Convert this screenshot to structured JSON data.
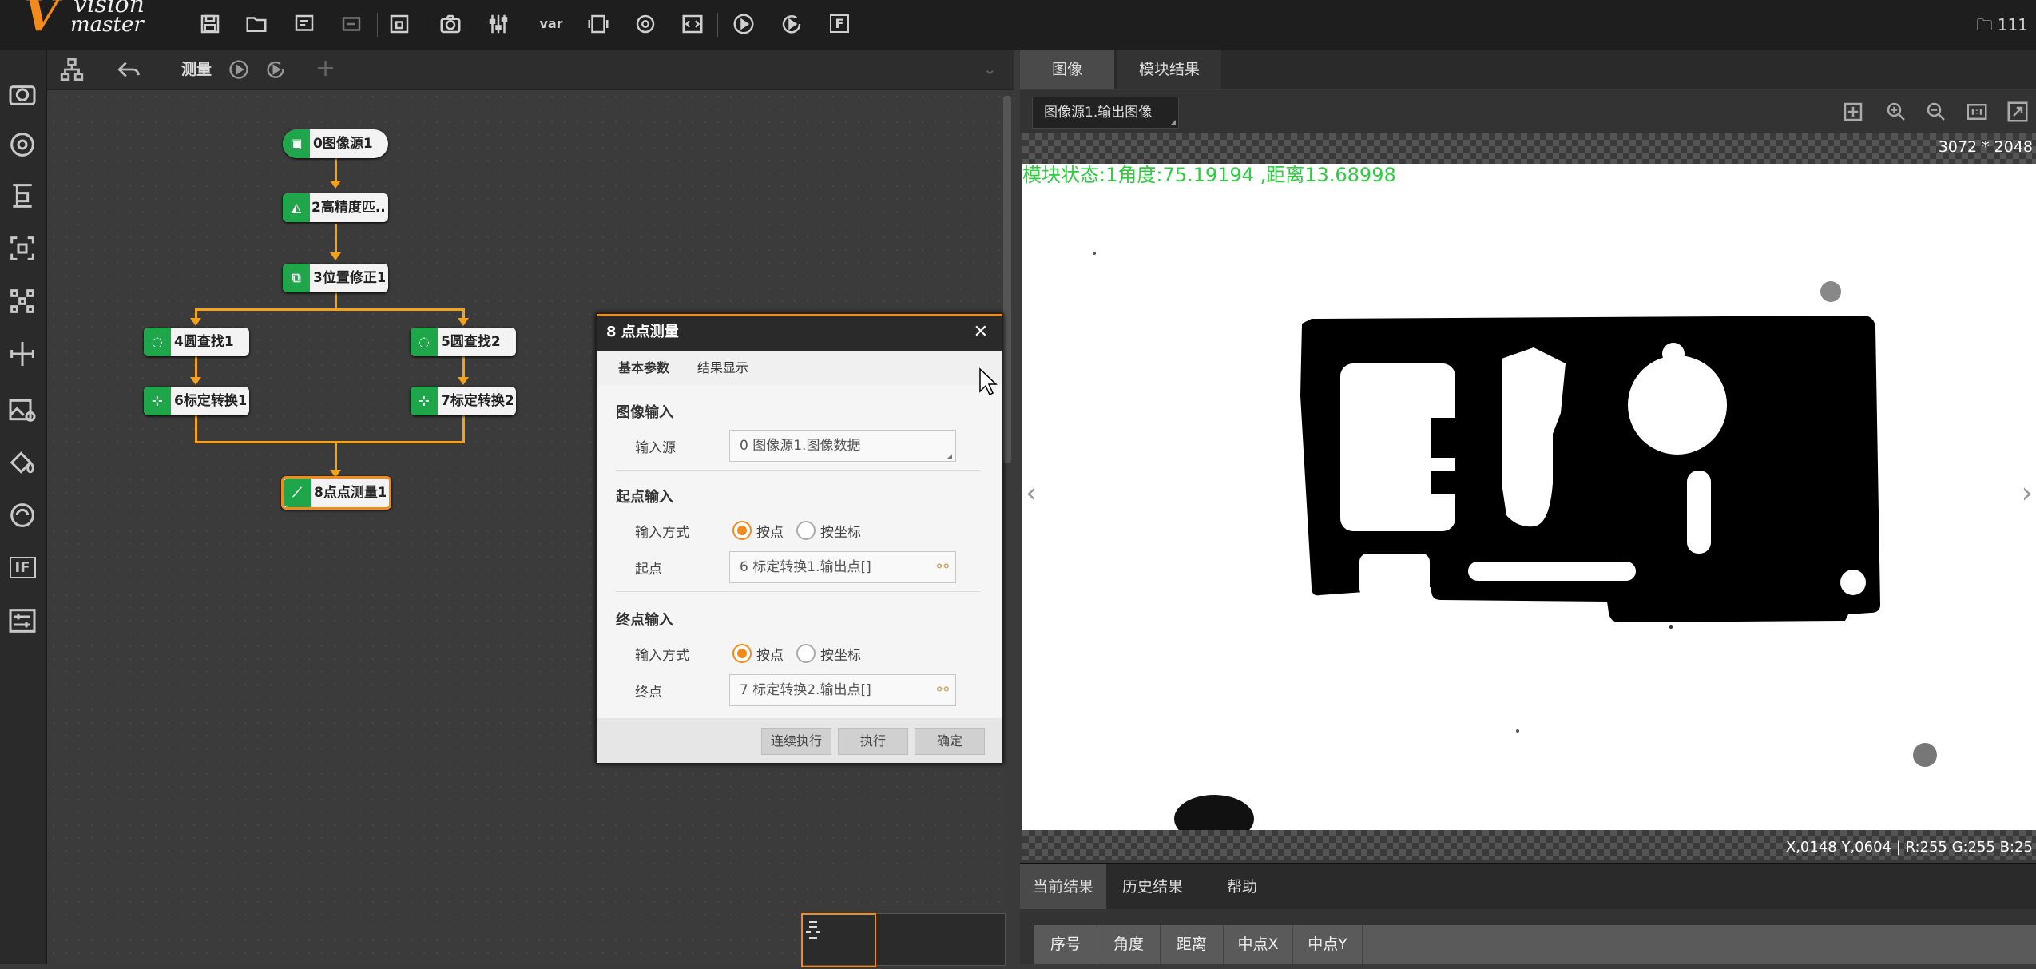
{
  "app": {
    "logo_v": "V",
    "logo_line1": "vision",
    "logo_line2": "master",
    "project_label": "111"
  },
  "toolbar": {
    "icons": [
      "save-icon",
      "open-folder-icon",
      "save-as-icon",
      "import-icon",
      "lock-icon",
      "camera-icon",
      "sliders-icon",
      "variable-icon",
      "device-icon",
      "communication-icon",
      "script-icon",
      "run-once-icon",
      "run-loop-icon",
      "function-icon"
    ],
    "var_label": "var",
    "f_label": "F"
  },
  "left_rail": {
    "icons": [
      "camera-icon",
      "locate-icon",
      "measure-icon",
      "crop-icon",
      "calibrate-icon",
      "align-icon",
      "image-process-icon",
      "color-icon",
      "defect-icon",
      "logic-if-icon",
      "settings-icon"
    ],
    "if_label": "IF"
  },
  "flow": {
    "tab_label": "测量",
    "nodes": [
      {
        "id": "n0",
        "label": "0图像源1"
      },
      {
        "id": "n2",
        "label": "2高精度匹..."
      },
      {
        "id": "n3",
        "label": "3位置修正1"
      },
      {
        "id": "n4",
        "label": "4圆查找1"
      },
      {
        "id": "n5",
        "label": "5圆查找2"
      },
      {
        "id": "n6",
        "label": "6标定转换1"
      },
      {
        "id": "n7",
        "label": "7标定转换2"
      },
      {
        "id": "n8",
        "label": "8点点测量1"
      }
    ]
  },
  "dialog": {
    "title": "8 点点测量",
    "close": "✕",
    "tabs": [
      "基本参数",
      "结果显示"
    ],
    "image_input": {
      "section": "图像输入",
      "label": "输入源",
      "value": "0 图像源1.图像数据"
    },
    "start_input": {
      "section": "起点输入",
      "mode_label": "输入方式",
      "opt1": "按点",
      "opt2": "按坐标",
      "point_label": "起点",
      "value": "6 标定转换1.输出点[]"
    },
    "end_input": {
      "section": "终点输入",
      "mode_label": "输入方式",
      "opt1": "按点",
      "opt2": "按坐标",
      "point_label": "终点",
      "value": "7 标定转换2.输出点[]"
    },
    "buttons": {
      "continuous": "连续执行",
      "execute": "执行",
      "confirm": "确定"
    }
  },
  "right_panel": {
    "tabs": [
      "图像",
      "模块结果"
    ],
    "image_source": "图像源1.输出图像",
    "resolution": "3072 * 2048",
    "status_text": "模块状态:1角度:75.19194 ,距离13.68998",
    "pixel_info": "X,0148  Y,0604  |  R:255  G:255  B:25"
  },
  "results": {
    "tabs": [
      "当前结果",
      "历史结果",
      "帮助"
    ],
    "columns": [
      "序号",
      "角度",
      "距离",
      "中点X",
      "中点Y"
    ]
  }
}
